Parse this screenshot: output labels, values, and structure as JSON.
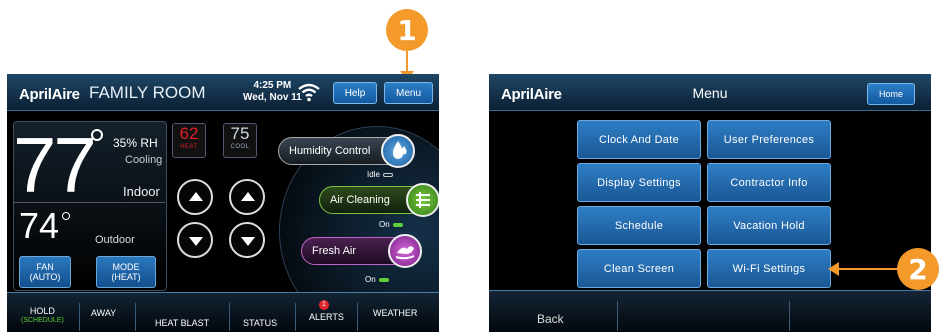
{
  "callouts": {
    "one": "1",
    "two": "2"
  },
  "thermostat": {
    "brand": "AprilAire",
    "room": "FAMILY ROOM",
    "time": "4:25 PM",
    "date": "Wed, Nov 11",
    "help_label": "Help",
    "menu_label": "Menu",
    "indoor_temp": "77",
    "humidity": "35% RH",
    "status": "Cooling",
    "indoor_label": "Indoor",
    "outdoor_temp": "74",
    "outdoor_label": "Outdoor",
    "fan_label": "FAN",
    "fan_value": "(AUTO)",
    "mode_label": "MODE",
    "mode_value": "(HEAT)",
    "heat_setpoint": "62",
    "heat_label": "HEAT",
    "cool_setpoint": "75",
    "cool_label": "COOL",
    "humidity_control": "Humidity Control",
    "humidity_status": "Idle",
    "air_cleaning": "Air Cleaning",
    "air_cleaning_status": "On",
    "fresh_air": "Fresh Air",
    "fresh_air_status": "On",
    "nav": {
      "hold": "HOLD",
      "hold_sub": "(SCHEDULE)",
      "away": "AWAY",
      "heat_blast": "HEAT BLAST",
      "status": "STATUS",
      "alerts": "ALERTS",
      "alerts_count": "1",
      "weather": "WEATHER"
    }
  },
  "menu_screen": {
    "brand": "AprilAire",
    "title": "Menu",
    "home_label": "Home",
    "items": [
      "Clock And Date",
      "User Preferences",
      "Display Settings",
      "Contractor Info",
      "Schedule",
      "Vacation Hold",
      "Clean Screen",
      "Wi-Fi Settings"
    ],
    "back_label": "Back"
  },
  "colors": {
    "callout": "#f39a2b",
    "heat": "#e0202a",
    "button_blue": "#1e64a8",
    "led_green": "#5ecf36"
  }
}
